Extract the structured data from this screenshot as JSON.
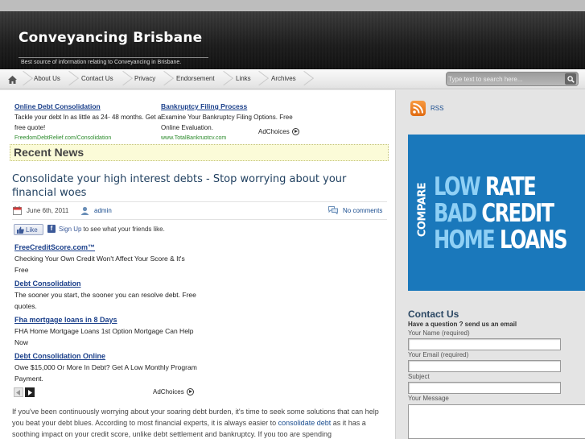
{
  "header": {
    "title": "Conveyancing Brisbane",
    "tagline": "Best source of information relating to Conveyancing in Brisbane."
  },
  "nav": {
    "items": [
      "About Us",
      "Contact Us",
      "Privacy",
      "Endorsement",
      "Links",
      "Archives"
    ],
    "search_placeholder": "Type text to search here..."
  },
  "top_ads": [
    {
      "title": "Online Debt Consolidation",
      "body": "Tackle your debt In as little as 24- 48 months. Get a free quote!",
      "url": "FreedomDebtRelief.com/Consolidation"
    },
    {
      "title": "Bankruptcy Filing Process",
      "body": "Examine Your Bankruptcy Filing Options. Free Online Evaluation.",
      "url": "www.TotalBankruptcy.com"
    }
  ],
  "adchoices_label": "AdChoices",
  "recent_news": "Recent News",
  "post": {
    "title": "Consolidate your high interest debts - Stop worrying about your financial woes",
    "date": "June 6th, 2011",
    "author": "admin",
    "comments": "No comments",
    "fb_like": "Like",
    "fb_signup": "Sign Up",
    "fb_signup_rest": "to see what your friends like.",
    "body_pre": "If you've been continuously worrying about your soaring debt burden, it's time to seek some solutions that can help you beat your debt blues. According to most financial experts, it is always easier to ",
    "body_link": "consolidate debt",
    "body_post": " as it has a soothing impact on your credit score, unlike debt settlement and bankruptcy. If you too are spending"
  },
  "inline_ads": [
    {
      "title": "FreeCreditScore.com™",
      "body": "Checking Your Own Credit Won't Affect Your Score & It's Free"
    },
    {
      "title": "Debt Consolidation",
      "body": "The sooner you start, the sooner you can resolve debt. Free quotes."
    },
    {
      "title": "Fha mortgage loans in 8 Days",
      "body": "FHA Home Mortgage Loans 1st Option Mortgage Can Help Now"
    },
    {
      "title": "Debt Consolidation Online",
      "body": "Owe $15,000 Or More In Debt? Get A Low Monthly Program Payment."
    }
  ],
  "sidebar": {
    "rss": "RSS",
    "banner": {
      "compare": "COMPARE",
      "lines": [
        {
          "a": "LOW",
          "b": " RATE"
        },
        {
          "a": "BAD",
          "b": " CREDIT"
        },
        {
          "a": "HOME",
          "b": " LOANS"
        }
      ],
      "color_light": "#8fd0f5",
      "color_white": "#ffffff",
      "bg": "#1a78bb"
    },
    "contact": {
      "title": "Contact Us",
      "subtitle": "Have a question ? send us an email",
      "name_label": "Your Name (required)",
      "email_label": "Your Email (required)",
      "subject_label": "Subject",
      "message_label": "Your Message"
    }
  }
}
